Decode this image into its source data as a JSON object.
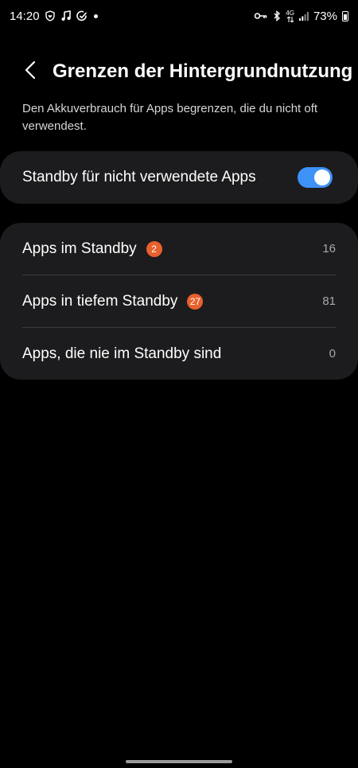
{
  "status_bar": {
    "time": "14:20",
    "left_icons": [
      "shield-heart-icon",
      "music-note-icon",
      "check-circle-icon",
      "notification-dot-icon"
    ],
    "right_icons": [
      "key-icon",
      "bluetooth-icon",
      "network-4g-icon",
      "signal-icon",
      "battery-icon"
    ],
    "network_label": "4G",
    "battery_percent": "73%"
  },
  "header": {
    "title": "Grenzen der Hintergrundnutzung"
  },
  "description": "Den Akkuverbrauch für Apps begrenzen, die du nicht oft verwendest.",
  "toggle": {
    "label": "Standby für nicht verwendete Apps",
    "on": true,
    "accent_color": "#3e91f7"
  },
  "list": {
    "rows": [
      {
        "label": "Apps im Standby",
        "badge": "2",
        "count": "16"
      },
      {
        "label": "Apps in tiefem Standby",
        "badge": "27",
        "count": "81"
      },
      {
        "label": "Apps, die nie im Standby sind",
        "badge": "",
        "count": "0"
      }
    ],
    "badge_color": "#e8602c"
  }
}
